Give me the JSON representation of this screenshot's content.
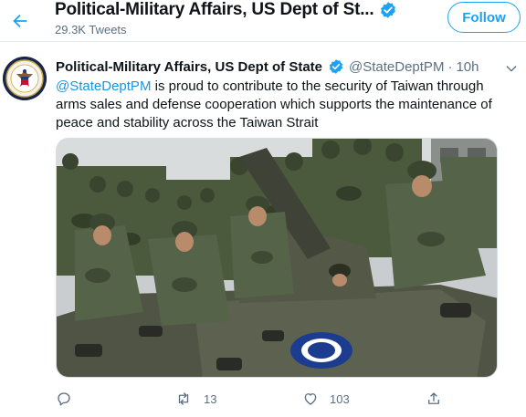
{
  "header": {
    "title": "Political-Military Affairs, US Dept of St...",
    "tweet_count": "29.3K Tweets",
    "follow_label": "Follow"
  },
  "tweet": {
    "author_name": "Political-Military Affairs, US Dept of State",
    "handle": "@StateDeptPM",
    "separator": "·",
    "time": "10h",
    "mention": "@StateDeptPM",
    "text": " is proud to contribute to the security of Taiwan through arms sales and defense cooperation which supports the maintenance of peace and stability across the Taiwan Strait",
    "replies": "",
    "retweets": "13",
    "likes": "103"
  },
  "icons": {
    "back": "back-arrow-icon",
    "verified": "verified-badge-icon",
    "more": "more-icon",
    "reply": "reply-icon",
    "retweet": "retweet-icon",
    "like": "heart-icon",
    "share": "share-icon"
  },
  "colors": {
    "accent": "#1da1f2",
    "link": "#1b95e0",
    "secondary_text": "#5b7083"
  }
}
